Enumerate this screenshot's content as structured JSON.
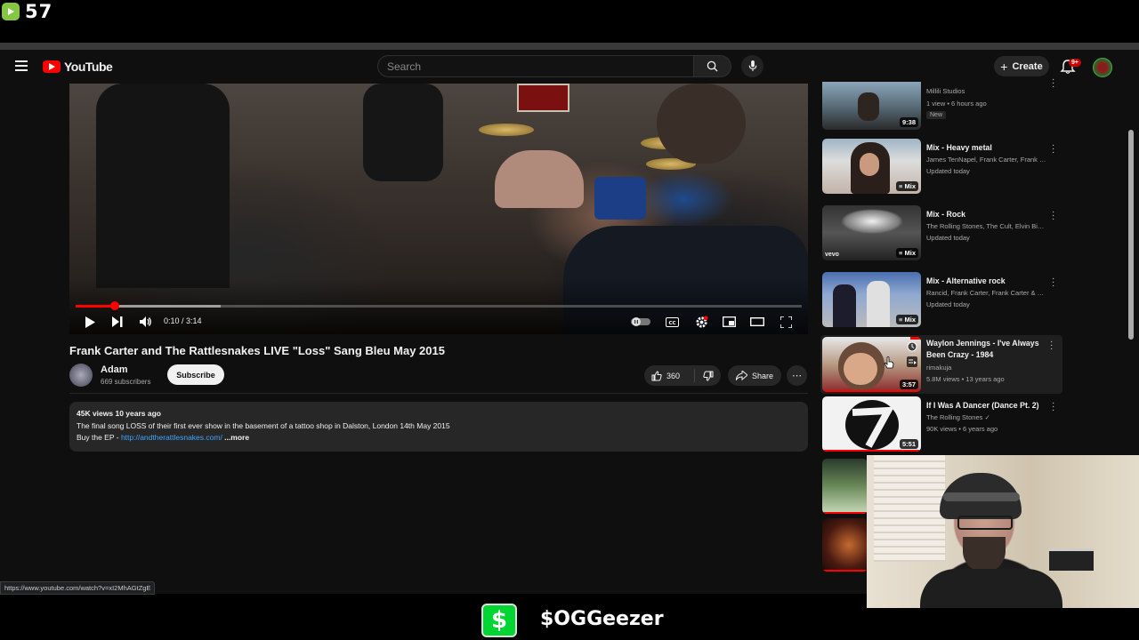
{
  "overlay": {
    "viewer_count": "57",
    "cashtag": "$OGGeezer",
    "cash_symbol": "$"
  },
  "masthead": {
    "logo_text": "YouTube",
    "search_placeholder": "Search",
    "create_label": "Create",
    "notification_badge": "9+"
  },
  "player": {
    "time": "0:10 / 3:14",
    "progress": 0.054
  },
  "video": {
    "title": "Frank Carter and The Rattlesnakes LIVE \"Loss\" Sang Bleu May 2015",
    "channel": "Adam",
    "subscribers": "669 subscribers",
    "subscribe_label": "Subscribe",
    "likes": "360",
    "share_label": "Share",
    "description": {
      "meta": "45K views  10 years ago",
      "line1": "The final song LOSS of their first ever show in the basement of a tattoo shop in Dalston, London 14th May 2015",
      "line2_prefix": "Buy the EP - ",
      "link": "http://andtherattlesnakes.com/",
      "more": " ...more"
    }
  },
  "recommendations": [
    {
      "title": "",
      "channel": "Millili Studios",
      "meta": "1 view • 6 hours ago",
      "badge": "9:38",
      "tag": "New"
    },
    {
      "title": "Mix - Heavy metal",
      "channel": "James TenNapel, Frank Carter, Frank Car...",
      "meta": "Updated today",
      "badge": "Mix"
    },
    {
      "title": "Mix - Rock",
      "channel": "The Rolling Stones, The Cult, Elvin Bisho...",
      "meta": "Updated today",
      "badge": "Mix"
    },
    {
      "title": "Mix - Alternative rock",
      "channel": "Rancid, Frank Carter, Frank Carter & The ...",
      "meta": "Updated today",
      "badge": "Mix"
    },
    {
      "title": "Waylon Jennings - I've Always Been Crazy - 1984",
      "channel": "rimakuja",
      "meta": "5.8M views • 13 years ago",
      "badge": "3:57"
    },
    {
      "title": "If I Was A Dancer (Dance Pt. 2)",
      "channel": "The Rolling Stones",
      "meta": "90K views • 6 years ago",
      "badge": "5:51"
    }
  ],
  "status_url": "https://www.youtube.com/watch?v=xI2MhAGtZgE",
  "colors": {
    "accent": "#ff0000",
    "link": "#3ea6ff",
    "cash_green": "#00d632",
    "rumble_green": "#85c742"
  }
}
